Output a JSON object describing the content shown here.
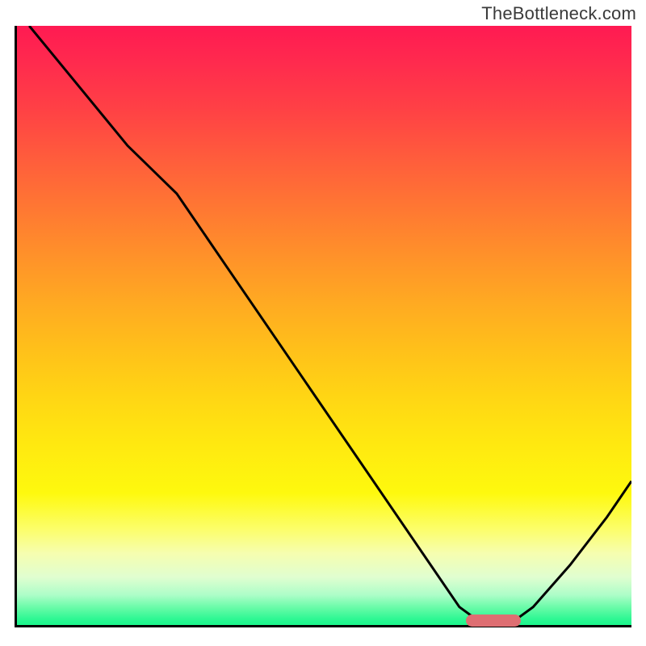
{
  "watermark": "TheBottleneck.com",
  "chart_data": {
    "type": "line",
    "title": "",
    "xlabel": "",
    "ylabel": "",
    "xlim": [
      0,
      100
    ],
    "ylim": [
      0,
      100
    ],
    "grid": false,
    "series": [
      {
        "name": "curve",
        "x": [
          2,
          10,
          18,
          26,
          34,
          42,
          50,
          58,
          66,
          72,
          76,
          80,
          84,
          90,
          96,
          100
        ],
        "values": [
          100,
          90,
          80,
          72,
          60,
          48,
          36,
          24,
          12,
          3,
          0,
          0,
          3,
          10,
          18,
          24
        ]
      }
    ],
    "optimal_marker": {
      "x_start": 73,
      "x_end": 82,
      "y": 0
    },
    "colors": {
      "gradient_top": "#ff1a52",
      "gradient_bottom": "#1bf68c",
      "curve": "#000000",
      "marker": "#de6e72",
      "axis": "#000000"
    }
  }
}
